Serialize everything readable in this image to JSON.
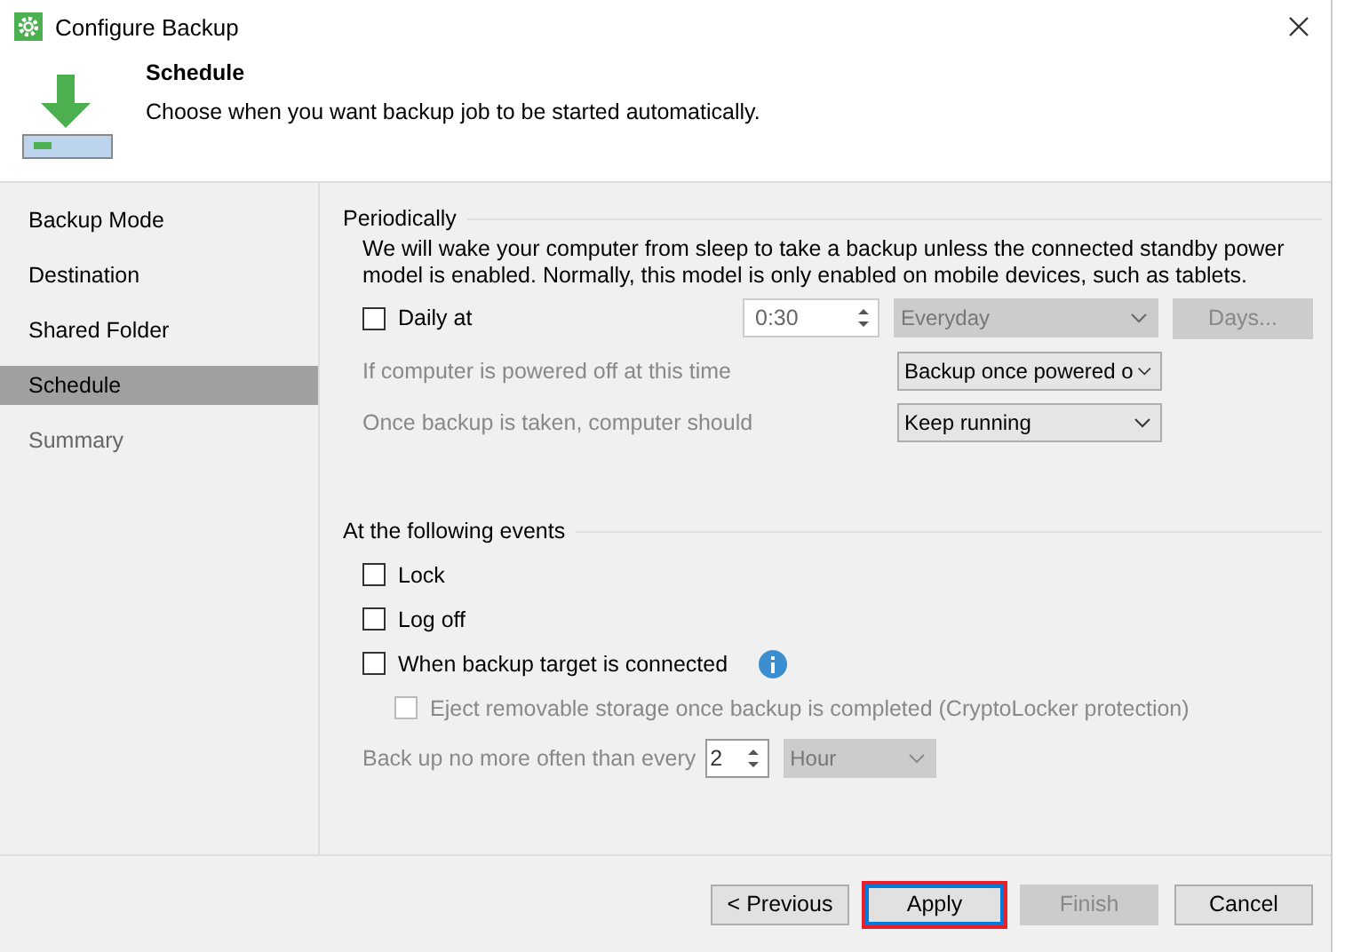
{
  "window": {
    "title": "Configure Backup"
  },
  "header": {
    "title": "Schedule",
    "subtitle": "Choose when you want backup job to be started automatically."
  },
  "sidebar": {
    "items": [
      {
        "label": "Backup Mode",
        "selected": false,
        "disabled": false
      },
      {
        "label": "Destination",
        "selected": false,
        "disabled": false
      },
      {
        "label": "Shared Folder",
        "selected": false,
        "disabled": false
      },
      {
        "label": "Schedule",
        "selected": true,
        "disabled": false
      },
      {
        "label": "Summary",
        "selected": false,
        "disabled": true
      }
    ]
  },
  "periodically": {
    "heading": "Periodically",
    "note": "We will wake your computer from sleep to take a backup unless the connected standby power model is enabled. Normally, this model is only enabled on mobile devices, such as tablets.",
    "daily": {
      "label": "Daily at",
      "checked": false
    },
    "time": {
      "value": "0:30"
    },
    "frequency": {
      "value": "Everyday",
      "disabled": true
    },
    "days_button": {
      "label": "Days...",
      "disabled": true
    },
    "rows": [
      {
        "label": "If computer is powered off at this time",
        "value": "Backup once powered o",
        "disabled": true
      },
      {
        "label": "Once backup is taken, computer should",
        "value": "Keep running",
        "disabled": true
      }
    ]
  },
  "events": {
    "heading": "At the following events",
    "options": [
      {
        "kind": "option",
        "label": "Lock",
        "checked": false,
        "disabled": false
      },
      {
        "kind": "option",
        "label": "Log off",
        "checked": false,
        "disabled": false
      },
      {
        "kind": "option_with_info",
        "label": "When backup target is connected",
        "checked": false,
        "disabled": false
      },
      {
        "kind": "sub_option",
        "label": "Eject removable storage once backup is completed (CryptoLocker protection)",
        "checked": false,
        "disabled": true
      }
    ],
    "limit": {
      "label": "Back up no more often than every",
      "value": "2",
      "unit": "Hour",
      "disabled": true
    }
  },
  "buttons": [
    {
      "label": "< Previous",
      "disabled": false,
      "highlighted": false
    },
    {
      "label": "Apply",
      "disabled": false,
      "highlighted": true
    },
    {
      "label": "Finish",
      "disabled": true,
      "highlighted": false
    },
    {
      "label": "Cancel",
      "disabled": false,
      "highlighted": false
    }
  ]
}
